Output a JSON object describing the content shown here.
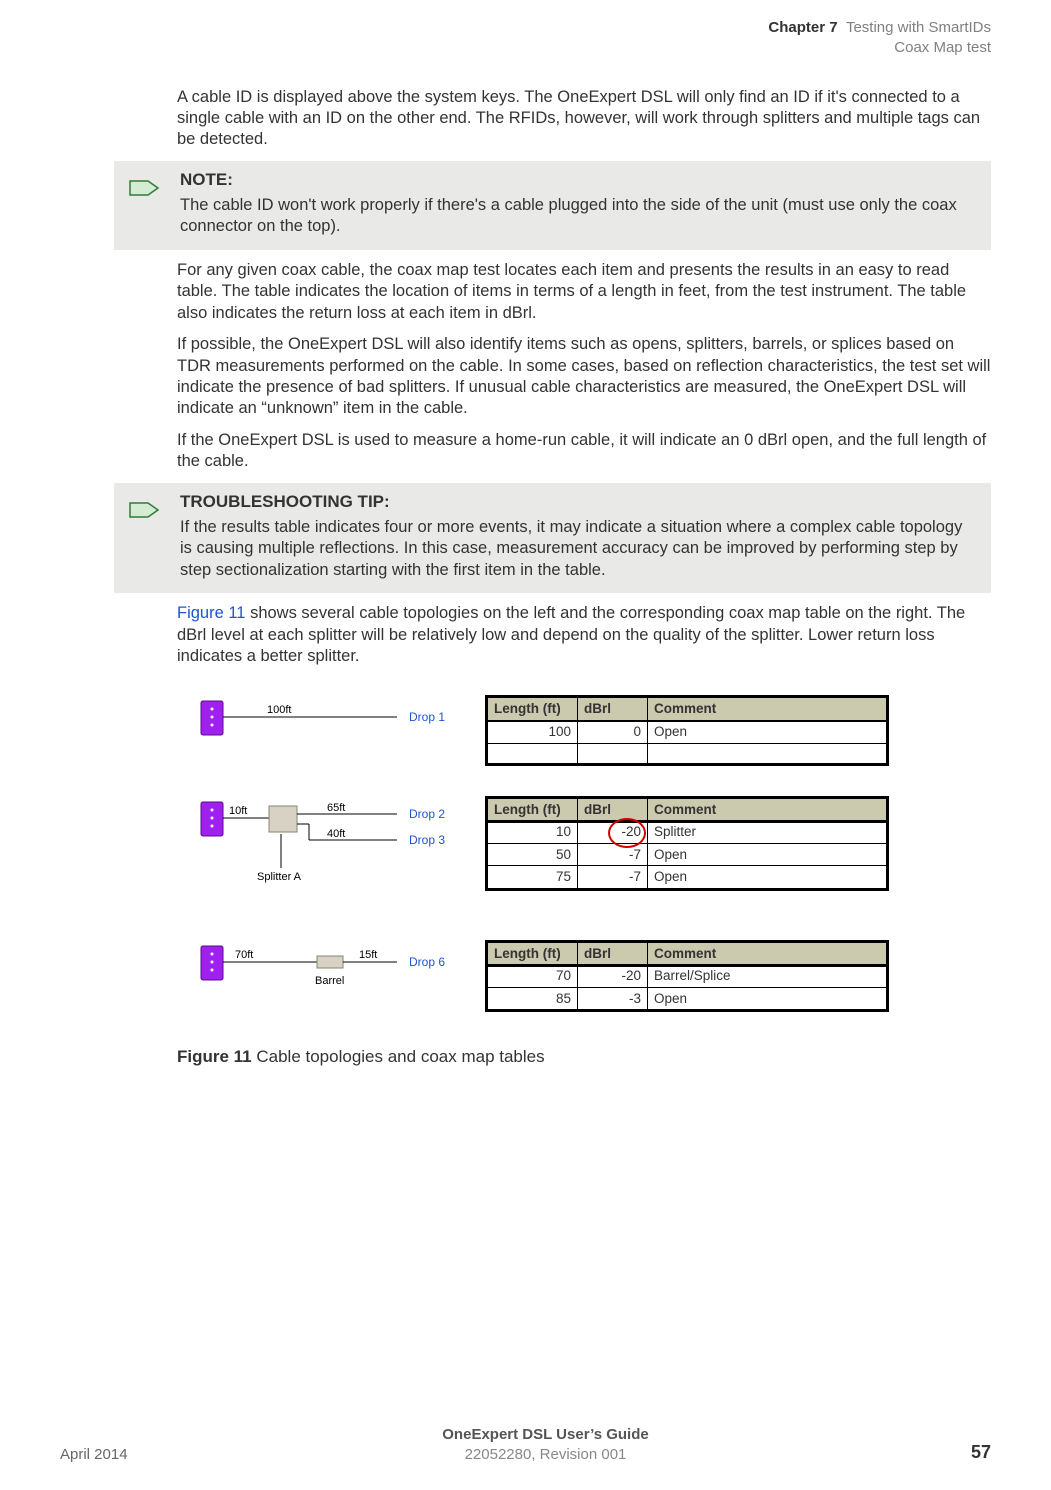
{
  "header": {
    "chapter": "Chapter 7",
    "section1": "Testing with SmartIDs",
    "section2": "Coax Map test"
  },
  "paragraphs": {
    "p1": "A cable ID is displayed above the system keys. The OneExpert DSL will only find an ID if it's connected to a single cable with an ID on the other end. The RFIDs, however, will work through splitters and multiple tags can be detected.",
    "p2": "For any given coax cable, the coax map test locates each item and presents the results in an easy to read table. The table indicates the location of items in terms of a length in feet, from the test instrument. The table also indicates the return loss at each item in dBrl.",
    "p3": "If possible, the OneExpert DSL will also identify items such as opens, splitters, barrels, or splices based on TDR measurements performed on the cable. In some cases, based on reflection characteristics, the test set will indicate the presence of bad splitters. If unusual cable characteristics are measured, the OneExpert DSL will indicate an “unknown” item in the cable.",
    "p4": "If the OneExpert DSL is used to measure a home-run cable, it will indicate an 0 dBrl open, and the full length of the cable.",
    "p5a": "Figure 11",
    "p5b": " shows several cable topologies on the left and the corresponding coax map table on the right. The dBrl level at each splitter will be relatively low and depend on the quality of the splitter. Lower return loss indicates a better splitter."
  },
  "note": {
    "title": "NOTE:",
    "body": "The cable ID won't work properly if there's a cable plugged into the side of the unit (must use only the coax connector on the top)."
  },
  "tip": {
    "title": "TROUBLESHOOTING TIP:",
    "body": "If the results table indicates four or more events, it may indicate a situation where a complex cable topology is causing multiple reflections. In this case, measurement accuracy can be improved by performing step by step sectionalization starting with the first item in the table."
  },
  "figure": {
    "caption_num": "Figure 11",
    "caption_text": "  Cable topologies and coax map tables",
    "table_headers": {
      "len": "Length (ft)",
      "db": "dBrl",
      "comment": "Comment"
    },
    "topo1": {
      "len1": "100ft",
      "drop1": "Drop 1",
      "rows": [
        {
          "len": "100",
          "db": "0",
          "comment": "Open"
        },
        {
          "len": "",
          "db": "",
          "comment": ""
        }
      ]
    },
    "topo2": {
      "len_in": "10ft",
      "len_a": "65ft",
      "len_b": "40ft",
      "drop2": "Drop 2",
      "drop3": "Drop 3",
      "splitter": "Splitter A",
      "rows": [
        {
          "len": "10",
          "db": "-20",
          "comment": "Splitter"
        },
        {
          "len": "50",
          "db": "-7",
          "comment": "Open"
        },
        {
          "len": "75",
          "db": "-7",
          "comment": "Open"
        }
      ]
    },
    "topo3": {
      "len_in": "70ft",
      "len_out": "15ft",
      "barrel": "Barrel",
      "drop6": "Drop 6",
      "rows": [
        {
          "len": "70",
          "db": "-20",
          "comment": "Barrel/Splice"
        },
        {
          "len": "85",
          "db": "-3",
          "comment": "Open"
        }
      ]
    }
  },
  "footer": {
    "date": "April 2014",
    "guide_title": "OneExpert DSL User’s Guide",
    "revision": "22052280, Revision 001",
    "page": "57"
  }
}
